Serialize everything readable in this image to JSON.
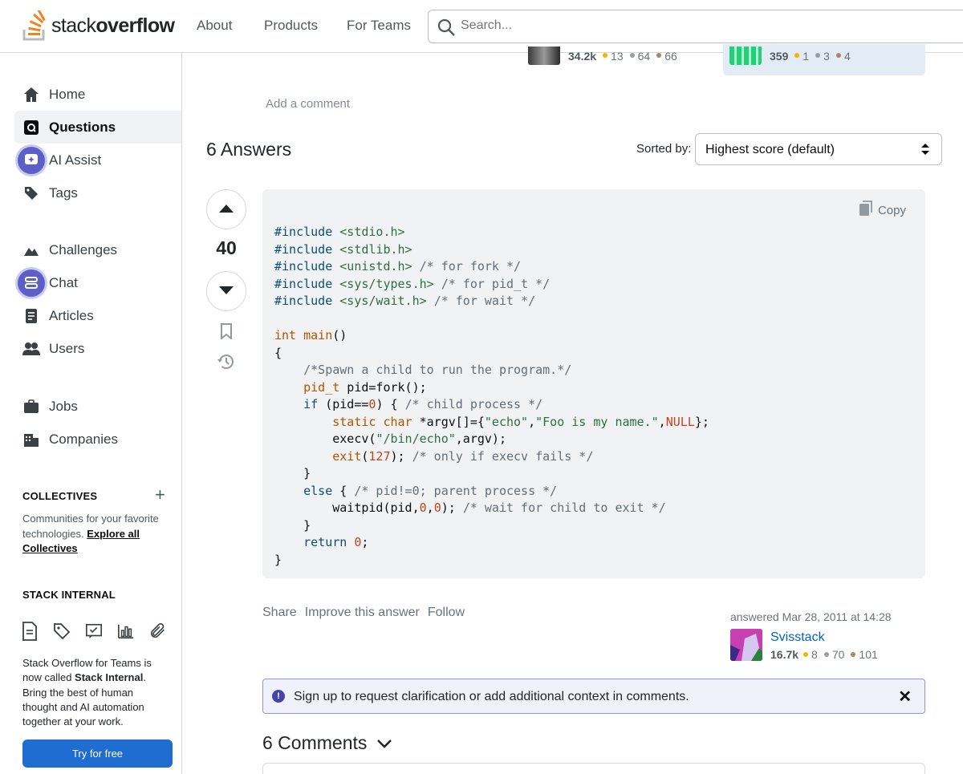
{
  "header": {
    "logo_stack": "stack",
    "logo_overflow": "overflow",
    "nav": [
      "About",
      "Products",
      "For Teams"
    ],
    "search_placeholder": "Search..."
  },
  "sidebar": {
    "items": [
      {
        "label": "Home",
        "icon": "home-icon"
      },
      {
        "label": "Questions",
        "icon": "questions-icon",
        "active": true
      },
      {
        "label": "AI Assist",
        "icon": "ai-assist-icon"
      },
      {
        "label": "Tags",
        "icon": "tag-icon"
      },
      {
        "label": "Challenges",
        "icon": "challenges-icon"
      },
      {
        "label": "Chat",
        "icon": "chat-icon"
      },
      {
        "label": "Articles",
        "icon": "articles-icon"
      },
      {
        "label": "Users",
        "icon": "users-icon"
      },
      {
        "label": "Jobs",
        "icon": "jobs-icon"
      },
      {
        "label": "Companies",
        "icon": "companies-icon"
      }
    ],
    "collectives_title": "COLLECTIVES",
    "collectives_text": "Communities for your favorite technologies.",
    "collectives_link": "Explore all Collectives",
    "internal_title": "STACK INTERNAL",
    "internal_text_1": "Stack Overflow for Teams is now called ",
    "internal_text_bold": "Stack Internal",
    "internal_text_2": ". Bring the best of human thought and AI automation together at your work.",
    "try_button": "Try for free"
  },
  "question_users": {
    "left": {
      "rep": "34.2k",
      "gold": "13",
      "silver": "64",
      "bronze": "66"
    },
    "right": {
      "rep": "359",
      "gold": "1",
      "silver": "3",
      "bronze": "4"
    }
  },
  "add_comment": "Add a comment",
  "answers": {
    "title": "6 Answers",
    "sorted_label": "Sorted by:",
    "sorted_value": "Highest score (default)"
  },
  "answer": {
    "score": "40",
    "copy_label": "Copy",
    "menu": [
      "Share",
      "Improve this answer",
      "Follow"
    ],
    "answered_text": "answered Mar 28, 2011 at 14:28",
    "user": {
      "name": "Svisstack",
      "rep": "16.7k",
      "gold": "8",
      "silver": "70",
      "bronze": "101"
    }
  },
  "notice": {
    "text": "Sign up to request clarification or add additional context in comments."
  },
  "comments_title": "6 Comments",
  "colors": {
    "accent": "#f48024",
    "link": "#0063bf",
    "button": "#1f6dd1",
    "notice_bg": "#f0f1fb",
    "code_bg": "#f1f2f3"
  }
}
